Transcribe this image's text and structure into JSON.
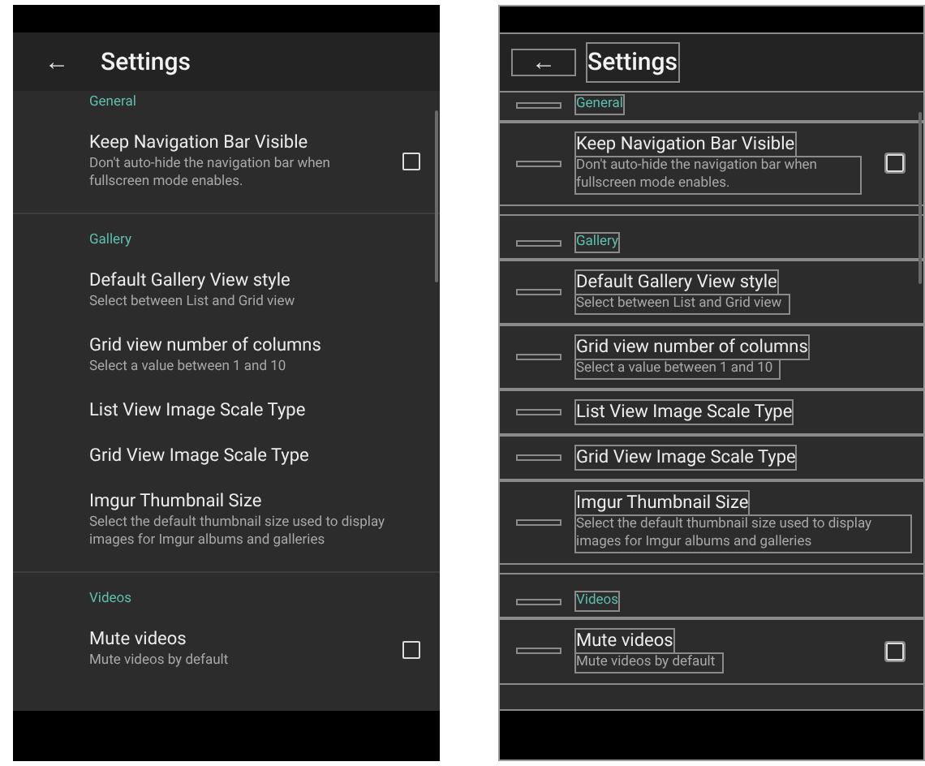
{
  "screens": [
    {
      "layout_bounds": false,
      "toolbar": {
        "back": "←",
        "title": "Settings"
      },
      "sections": [
        {
          "title": "General",
          "items": [
            {
              "kind": "checkbox",
              "title": "Keep Navigation Bar Visible",
              "summary": "Don't auto-hide the navigation bar when fullscreen mode enables.",
              "checked": false
            }
          ]
        },
        {
          "title": "Gallery",
          "items": [
            {
              "kind": "plain",
              "title": "Default Gallery View style",
              "summary": "Select between List and Grid view"
            },
            {
              "kind": "plain",
              "title": "Grid view number of columns",
              "summary": "Select a value between 1 and 10"
            },
            {
              "kind": "plain",
              "title": "List View Image Scale Type"
            },
            {
              "kind": "plain",
              "title": "Grid View Image Scale Type"
            },
            {
              "kind": "plain",
              "title": "Imgur Thumbnail Size",
              "summary": "Select the default thumbnail size used to display images for Imgur albums and galleries"
            }
          ]
        },
        {
          "title": "Videos",
          "items": [
            {
              "kind": "checkbox",
              "title": "Mute videos",
              "summary": "Mute videos by default",
              "checked": false
            }
          ]
        }
      ]
    },
    {
      "layout_bounds": true,
      "toolbar": {
        "back": "←",
        "title": "Settings"
      },
      "sections": [
        {
          "title": "General",
          "items": [
            {
              "kind": "checkbox",
              "title": "Keep Navigation Bar Visible",
              "summary": "Don't auto-hide the navigation bar when fullscreen mode enables.",
              "checked": false
            }
          ]
        },
        {
          "title": "Gallery",
          "items": [
            {
              "kind": "plain",
              "title": "Default Gallery View style",
              "summary": "Select between List and Grid view"
            },
            {
              "kind": "plain",
              "title": "Grid view number of columns",
              "summary": "Select a value between 1 and 10"
            },
            {
              "kind": "plain",
              "title": "List View Image Scale Type"
            },
            {
              "kind": "plain",
              "title": "Grid View Image Scale Type"
            },
            {
              "kind": "plain",
              "title": "Imgur Thumbnail Size",
              "summary": "Select the default thumbnail size used to display images for Imgur albums and galleries"
            }
          ]
        },
        {
          "title": "Videos",
          "items": [
            {
              "kind": "checkbox",
              "title": "Mute videos",
              "summary": "Mute videos by default",
              "checked": false
            }
          ]
        }
      ]
    }
  ]
}
